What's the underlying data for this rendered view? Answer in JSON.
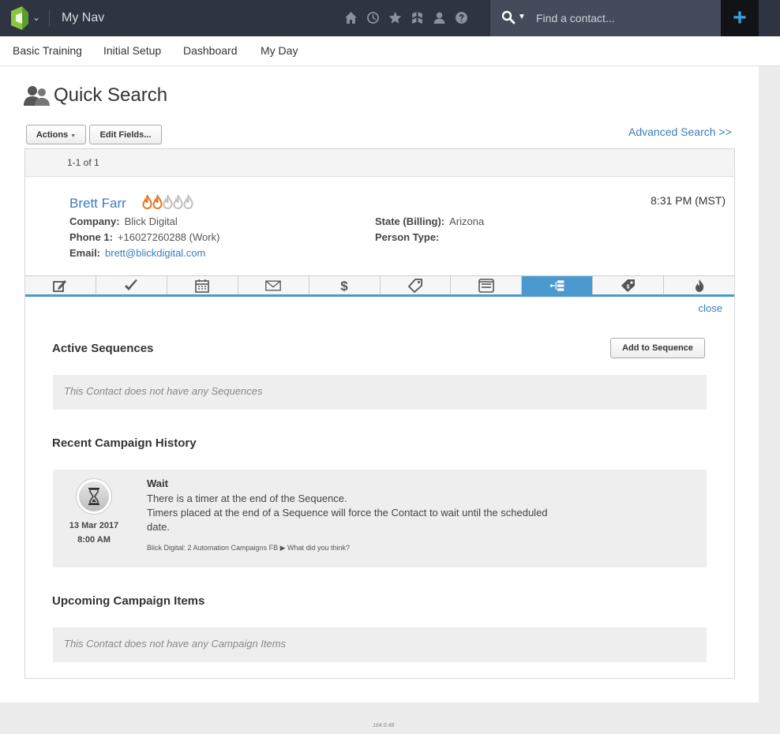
{
  "topbar": {
    "nav_title": "My Nav",
    "search_placeholder": "Find a contact...",
    "plus_label": "+",
    "icons": [
      "home-icon",
      "history-icon",
      "star-icon",
      "crm-icon",
      "person-icon",
      "help-icon"
    ]
  },
  "subnav": {
    "items": [
      "Basic Training",
      "Initial Setup",
      "Dashboard",
      "My Day"
    ]
  },
  "main": {
    "title": "Quick Search",
    "actions_label": "Actions",
    "edit_fields_label": "Edit Fields...",
    "advanced_search_label": "Advanced Search >>",
    "result_count": "1-1 of 1"
  },
  "contact": {
    "name": "Brett Farr",
    "timezone": "8:31 PM (MST)",
    "company_label": "Company:",
    "company": "Blick Digital",
    "phone_label": "Phone 1:",
    "phone": "+16027260288 (Work)",
    "email_label": "Email:",
    "email": "brett@blickdigital.com",
    "state_label": "State (Billing):",
    "state": "Arizona",
    "person_type_label": "Person Type:",
    "person_type": "",
    "score_of_5": 2,
    "colors": {
      "flame_on": "#e8741c",
      "flame_off": "#bfbfbf",
      "accent": "#4a9ad0"
    }
  },
  "tabs": {
    "icons": [
      "note-icon",
      "task-icon",
      "calendar-icon",
      "email-icon",
      "dollar-icon",
      "tag-icon",
      "list-icon",
      "sequence-icon",
      "price-tag-icon",
      "flame-icon"
    ],
    "active_index": 7
  },
  "panel": {
    "close_label": "close",
    "active_sequences_title": "Active Sequences",
    "add_to_sequence_label": "Add to Sequence",
    "no_sequences_text": "This Contact does not have any Sequences",
    "recent_history_title": "Recent Campaign History",
    "history": {
      "date": "13 Mar 2017",
      "time": "8:00 AM",
      "title": "Wait",
      "line1": "There is a timer at the end of the Sequence.",
      "line2": "Timers placed at the end of a Sequence will force the Contact to wait until the scheduled",
      "line3": "date.",
      "path": "Blick Digital: 2 Automation Campaigns FB ▶ What did you think?"
    },
    "upcoming_title": "Upcoming Campaign Items",
    "no_upcoming_text": "This Contact does not have any Campaign Items"
  },
  "footer": {
    "version": "164.0.48"
  }
}
